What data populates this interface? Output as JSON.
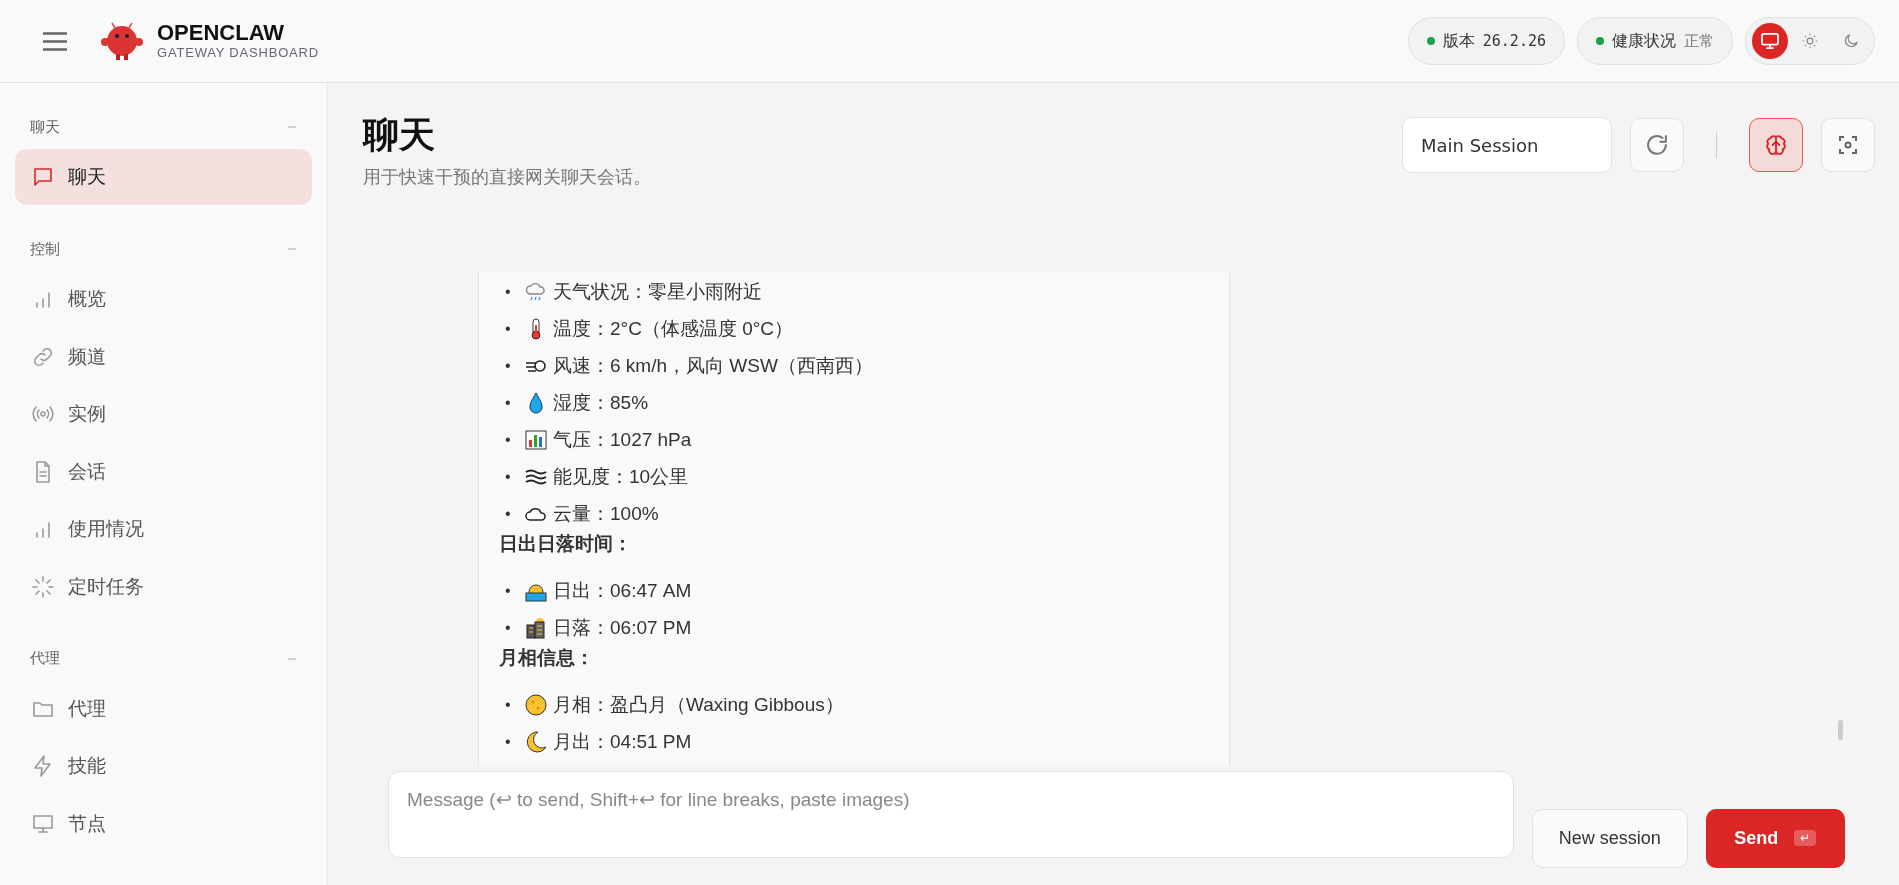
{
  "header": {
    "brand": "OPENCLAW",
    "subtitle": "GATEWAY DASHBOARD",
    "version": {
      "label": "版本",
      "value": "26.2.26"
    },
    "health": {
      "label": "健康状况",
      "value": "正常"
    },
    "theme": [
      {
        "kind": "system",
        "selected": true
      },
      {
        "kind": "light",
        "selected": false
      },
      {
        "kind": "dark",
        "selected": false
      }
    ]
  },
  "sidebar": {
    "groups": [
      {
        "title": "聊天",
        "expanded": true,
        "items": [
          {
            "label": "聊天",
            "selected": true
          }
        ]
      },
      {
        "title": "控制",
        "expanded": true,
        "items": [
          {
            "label": "概览",
            "selected": false
          },
          {
            "label": "频道",
            "selected": false
          },
          {
            "label": "实例",
            "selected": false
          },
          {
            "label": "会话",
            "selected": false
          },
          {
            "label": "使用情况",
            "selected": false
          },
          {
            "label": "定时任务",
            "selected": false
          }
        ]
      },
      {
        "title": "代理",
        "expanded": true,
        "items": [
          {
            "label": "代理",
            "selected": false
          },
          {
            "label": "技能",
            "selected": false
          },
          {
            "label": "节点",
            "selected": false
          }
        ]
      }
    ]
  },
  "page": {
    "title": "聊天",
    "subtitle": "用于快速干预的直接网关聊天会话。",
    "session": "Main Session",
    "thinking_on": true
  },
  "message": {
    "blocks": [
      {
        "kind": "list",
        "marker": "•",
        "items": [
          "天气状况：零星小雨附近",
          "温度：2°C（体感温度 0°C）",
          "风速：6 km/h，风向 WSW（西南西）",
          "湿度：85%",
          "气压：1027 hPa",
          "能见度：10公里",
          "云量：100%"
        ]
      },
      {
        "kind": "heading",
        "text": "日出日落时间："
      },
      {
        "kind": "list",
        "marker": "•",
        "items": [
          "日出：06:47 AM",
          "日落：06:07 PM"
        ]
      },
      {
        "kind": "heading",
        "text": "月相信息："
      },
      {
        "kind": "list",
        "marker": "•",
        "items": [
          "月相：盈凸月（Waxing Gibbous）",
          "月出：04:51 PM"
        ]
      }
    ]
  },
  "composer": {
    "placeholder": "Message (↩ to send, Shift+↩ for line breaks, paste images)",
    "new_session": "New session",
    "send": "Send",
    "send_key": "↵"
  }
}
